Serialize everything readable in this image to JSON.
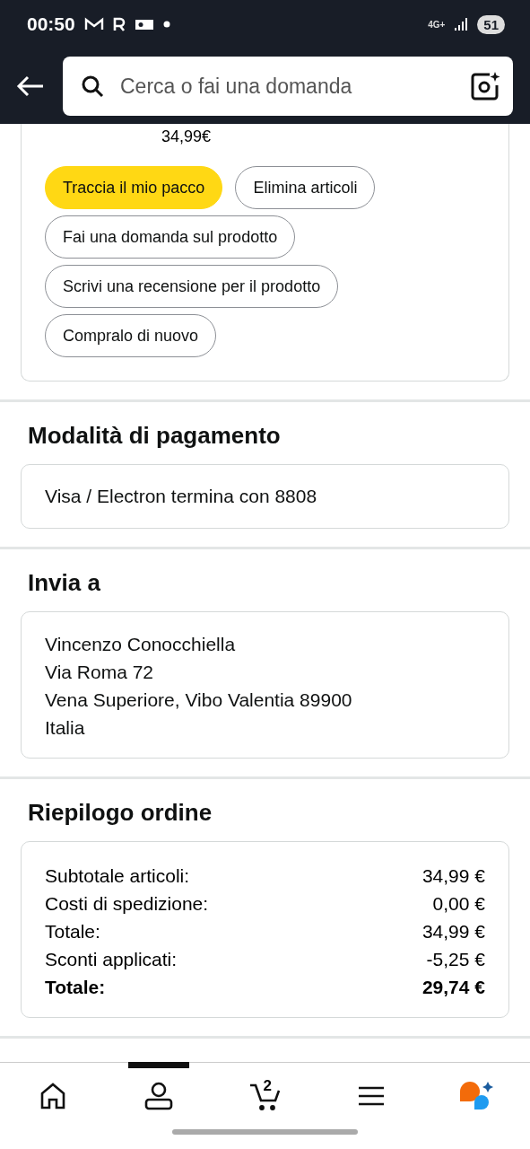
{
  "status_bar": {
    "time": "00:50",
    "network": "4G+",
    "battery": "51"
  },
  "search": {
    "placeholder": "Cerca o fai una domanda"
  },
  "order_item": {
    "price": "34,99€",
    "actions": [
      {
        "label": "Traccia il mio pacco",
        "kind": "primary"
      },
      {
        "label": "Elimina articoli",
        "kind": "secondary"
      },
      {
        "label": "Fai una domanda sul prodotto",
        "kind": "secondary"
      },
      {
        "label": "Scrivi una recensione per il prodotto",
        "kind": "secondary"
      },
      {
        "label": "Compralo di nuovo",
        "kind": "secondary"
      }
    ]
  },
  "payment": {
    "title": "Modalità di pagamento",
    "method": "Visa / Electron  termina con 8808"
  },
  "ship_to": {
    "title": "Invia a",
    "lines": [
      "Vincenzo Conocchiella",
      "Via Roma 72",
      "Vena Superiore, Vibo Valentia 89900",
      "Italia"
    ]
  },
  "summary": {
    "title": "Riepilogo ordine",
    "rows": [
      {
        "label": "Subtotale articoli:",
        "value": "34,99 €",
        "bold": false
      },
      {
        "label": "Costi di spedizione:",
        "value": "0,00 €",
        "bold": false
      },
      {
        "label": "Totale:",
        "value": "34,99 €",
        "bold": false
      },
      {
        "label": "Sconti applicati:",
        "value": "-5,25 €",
        "bold": false
      },
      {
        "label": "Totale:",
        "value": "29,74 €",
        "bold": true
      }
    ]
  },
  "bottom_nav": [
    {
      "kind": "home",
      "selected": false
    },
    {
      "kind": "account",
      "selected": true
    },
    {
      "kind": "cart",
      "badge": "2",
      "selected": false
    },
    {
      "kind": "menu",
      "selected": false
    },
    {
      "kind": "assistant",
      "selected": false
    }
  ]
}
